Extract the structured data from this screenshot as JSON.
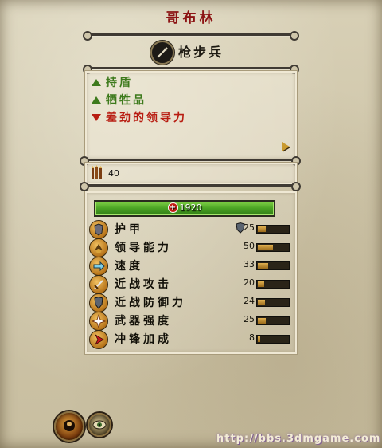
{
  "title": "哥布林",
  "unit": {
    "name": "枪步兵",
    "icon": "spear-icon"
  },
  "traits": [
    {
      "label": "持盾",
      "type": "positive",
      "color": "#3d7a1c"
    },
    {
      "label": "牺牲品",
      "type": "positive",
      "color": "#3d7a1c"
    },
    {
      "label": "差劲的领导力",
      "type": "negative",
      "color": "#b81d12"
    }
  ],
  "ammo": {
    "icon": "arrows-icon",
    "value": "40"
  },
  "health": {
    "value": "1920",
    "fraction": 1.0
  },
  "stats": [
    {
      "label": "护甲",
      "value": "25",
      "fraction": 0.25,
      "icon": "armor-icon",
      "shield": true
    },
    {
      "label": "领导能力",
      "value": "50",
      "fraction": 0.5,
      "icon": "leadership-icon"
    },
    {
      "label": "速度",
      "value": "33",
      "fraction": 0.33,
      "icon": "speed-icon"
    },
    {
      "label": "近战攻击",
      "value": "20",
      "fraction": 0.2,
      "icon": "melee-attack-icon"
    },
    {
      "label": "近战防御力",
      "value": "24",
      "fraction": 0.24,
      "icon": "melee-defence-icon"
    },
    {
      "label": "武器强度",
      "value": "25",
      "fraction": 0.25,
      "icon": "weapon-strength-icon"
    },
    {
      "label": "冲锋加成",
      "value": "8",
      "fraction": 0.08,
      "icon": "charge-bonus-icon"
    }
  ],
  "buttons": [
    {
      "icon": "unit-info-icon"
    },
    {
      "icon": "eye-icon"
    }
  ],
  "watermark": "http://bbs.3dmgame.com"
}
